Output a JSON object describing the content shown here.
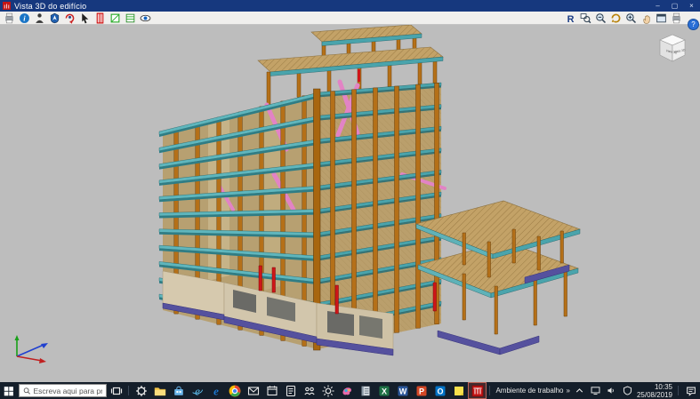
{
  "window": {
    "title": "Vista 3D do edifício",
    "controls": {
      "minimize": "–",
      "maximize": "▢",
      "close": "×"
    }
  },
  "toolbar": {
    "left_icons": [
      "print",
      "info",
      "person",
      "compass",
      "rotate-user",
      "pointer",
      "column-red",
      "panel-green",
      "slab-stripes",
      "eye"
    ],
    "right_icons": [
      "redraw",
      "zoom-window",
      "zoom-out",
      "rotate-view",
      "zoom-in",
      "pan",
      "full-window",
      "print-view"
    ],
    "help": "?"
  },
  "viewport": {
    "background": "#bdbdbd",
    "view_cube_label": "Vista 3D",
    "axis_colors": {
      "x": "#c02020",
      "y": "#2040d0",
      "z": "#18a018"
    },
    "model_colors": {
      "columns": "#b57018",
      "columns_dark": "#6b3f0a",
      "beams": "#4aa4ac",
      "beams_dark": "#1f5f66",
      "slab_edge": "#5fb6bd",
      "slab_under": "#2f7d85",
      "slab_top": "#c3a267",
      "hatch_line": "#9b7c45",
      "wall": "#b7a071",
      "ground_wall": "#d6c9ae",
      "foundation": "#55519e",
      "braces": "#e283c5",
      "tension_rods": "#cf1518"
    }
  },
  "taskbar": {
    "search_placeholder": "Escreva aqui para procurar",
    "app_icons": [
      "task-view",
      "settings",
      "file-explorer",
      "store",
      "internet-explorer",
      "edge",
      "chrome",
      "mail",
      "calendar",
      "todo",
      "people",
      "weather",
      "paint3d",
      "onenote",
      "excel",
      "word",
      "powerpoint",
      "outlook",
      "sticky-notes",
      "cype"
    ],
    "active_app": "cype",
    "tray": {
      "desktop_toolbar_label": "Ambiente de trabalho",
      "overflow_chevron": "»",
      "time": "10:35",
      "date": "25/08/2019"
    }
  }
}
